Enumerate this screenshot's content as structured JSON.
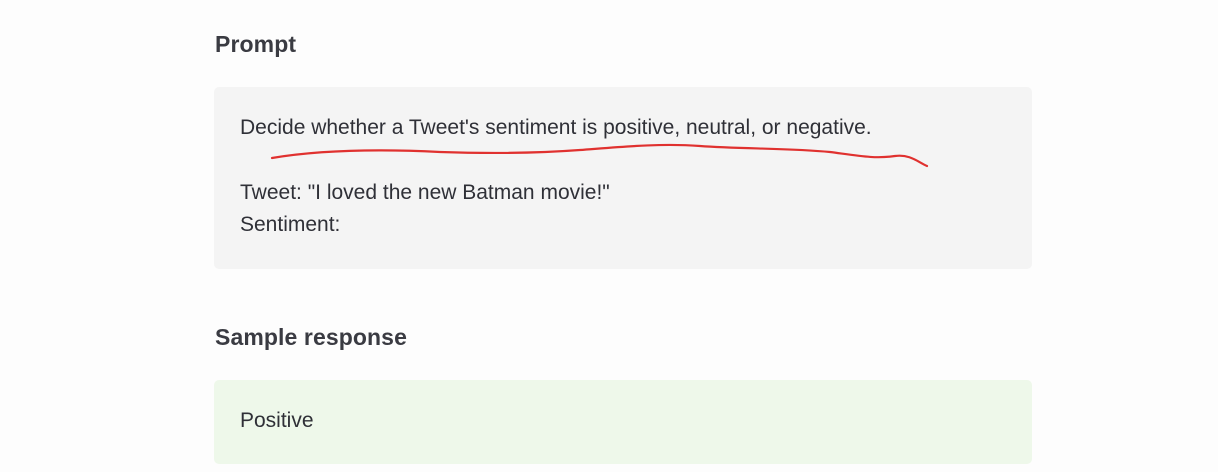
{
  "prompt_section": {
    "heading": "Prompt",
    "instruction": "Decide whether a Tweet's sentiment is positive, neutral, or negative.",
    "tweet": "Tweet: \"I loved the new Batman movie!\"",
    "sentiment_label": "Sentiment:"
  },
  "annotation": {
    "color": "#e0312f",
    "kind": "hand-drawn-underline"
  },
  "response_section": {
    "heading": "Sample response",
    "text": "Positive",
    "background_color": "#eef8ea"
  }
}
